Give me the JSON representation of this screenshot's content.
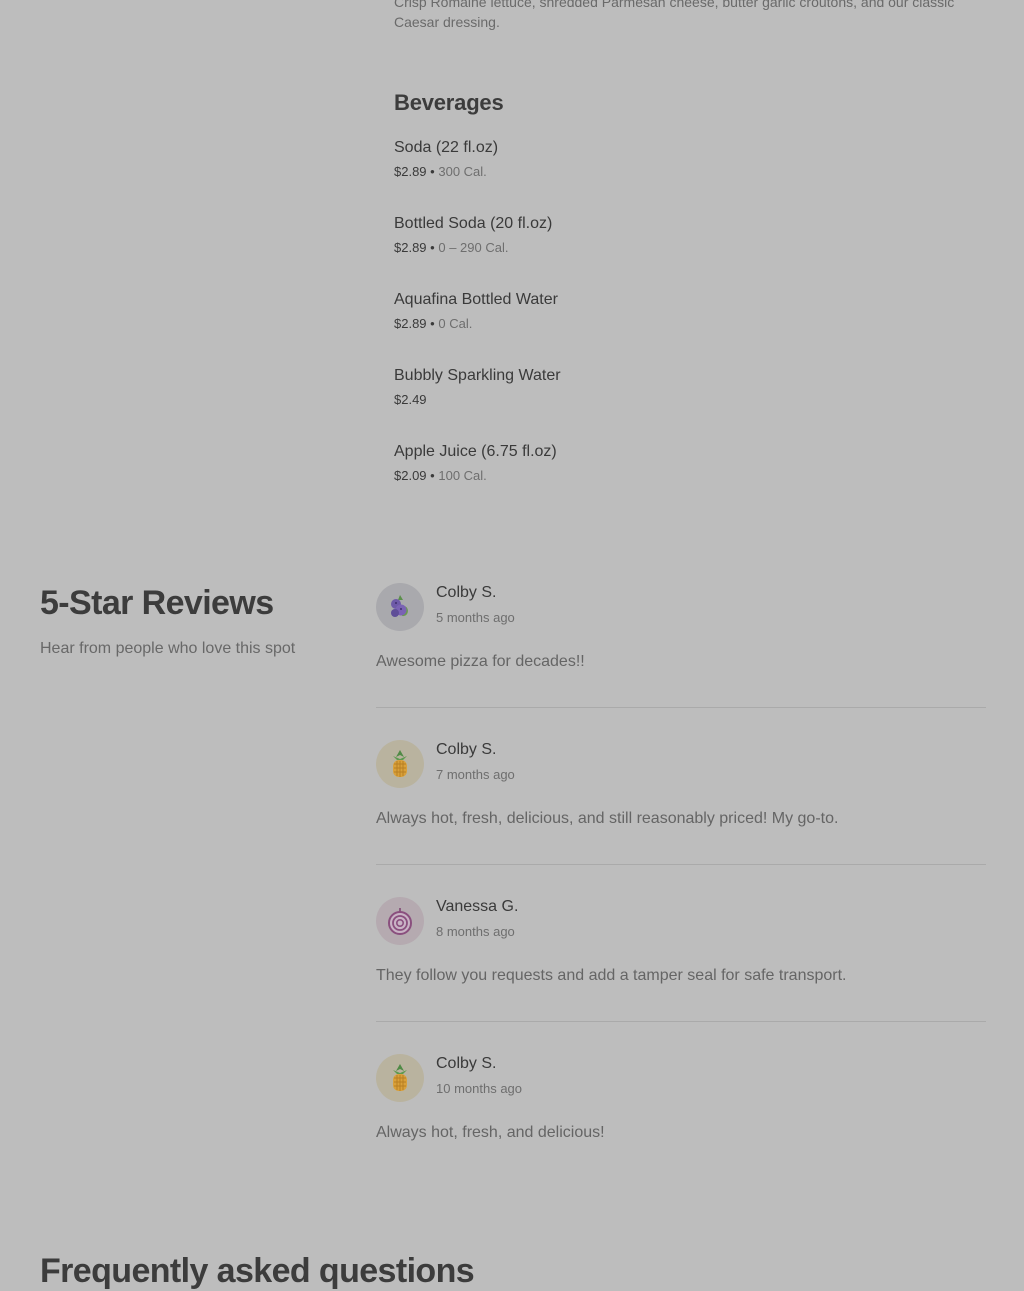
{
  "top_item": {
    "description": "Crisp Romaine lettuce, shredded Parmesan cheese, butter garlic croutons, and our classic Caesar dressing."
  },
  "beverages": {
    "title": "Beverages",
    "items": [
      {
        "name": "Soda (22 fl.oz)",
        "price": "$2.89",
        "calories": "300 Cal."
      },
      {
        "name": "Bottled Soda (20 fl.oz)",
        "price": "$2.89",
        "calories": "0 – 290 Cal."
      },
      {
        "name": "Aquafina Bottled Water",
        "price": "$2.89",
        "calories": "0 Cal."
      },
      {
        "name": "Bubbly Sparkling Water",
        "price": "$2.49",
        "calories": ""
      },
      {
        "name": "Apple Juice (6.75 fl.oz)",
        "price": "$2.09",
        "calories": "100 Cal."
      }
    ]
  },
  "reviews": {
    "title": "5-Star Reviews",
    "subtitle": "Hear from people who love this spot",
    "items": [
      {
        "name": "Colby S.",
        "time": "5 months ago",
        "text": "Awesome pizza for decades!!",
        "avatar_icon": "blueberry-icon",
        "avatar_bg": "#a9a9ad"
      },
      {
        "name": "Colby S.",
        "time": "7 months ago",
        "text": "Always hot, fresh, delicious, and still reasonably priced! My go-to.",
        "avatar_icon": "pineapple-icon",
        "avatar_bg": "#b9b39f"
      },
      {
        "name": "Vanessa G.",
        "time": "8 months ago",
        "text": "They follow you requests and add a tamper seal for safe transport.",
        "avatar_icon": "onion-icon",
        "avatar_bg": "#b5aab0"
      },
      {
        "name": "Colby S.",
        "time": "10 months ago",
        "text": "Always hot, fresh, and delicious!",
        "avatar_icon": "pineapple-icon",
        "avatar_bg": "#b9b39f"
      }
    ]
  },
  "faq": {
    "title": "Frequently asked questions"
  }
}
